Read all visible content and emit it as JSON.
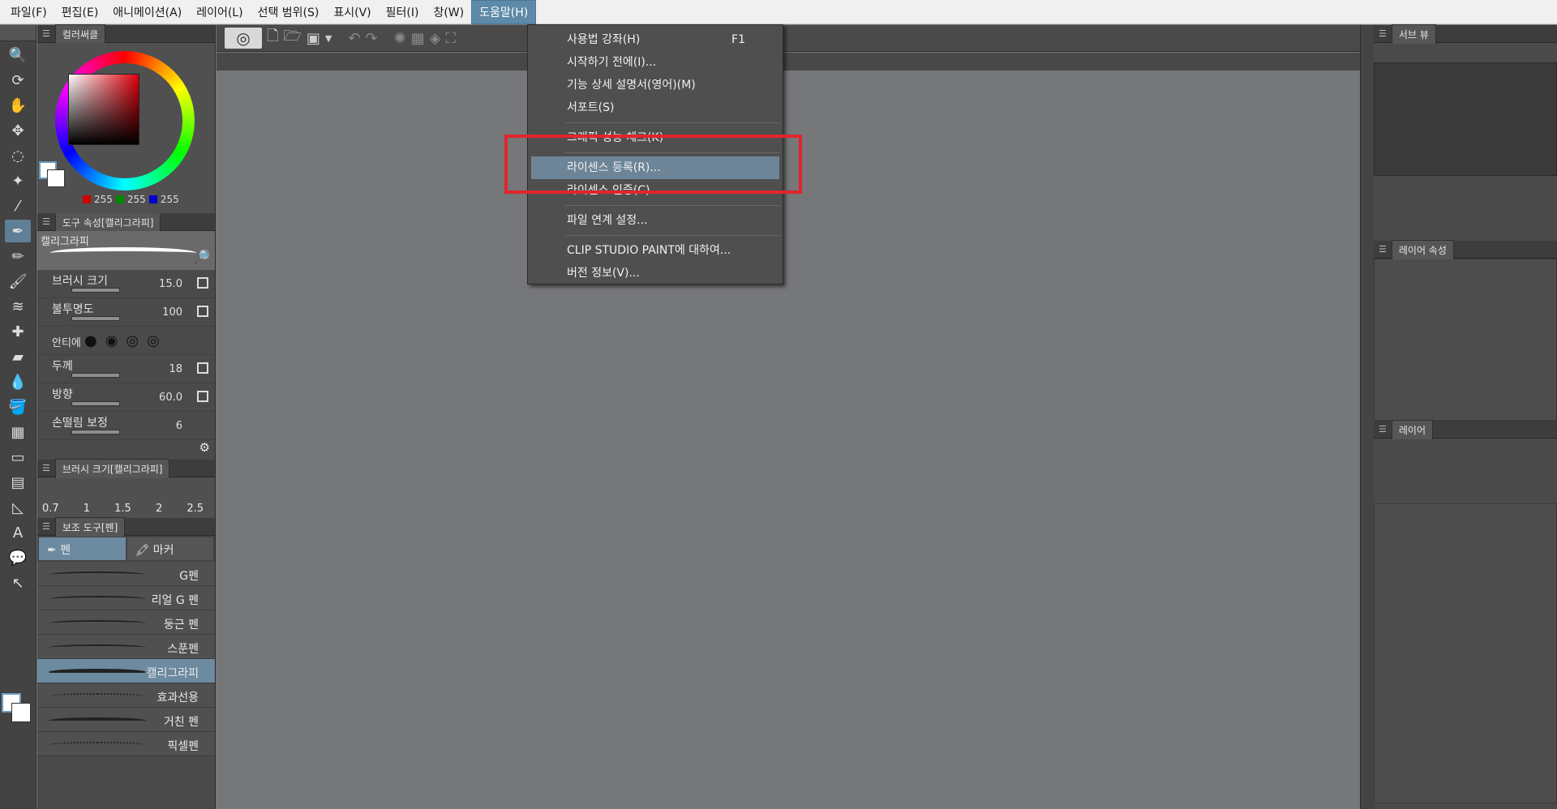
{
  "menubar": {
    "items": [
      "파일(F)",
      "편집(E)",
      "애니메이션(A)",
      "레이어(L)",
      "선택 범위(S)",
      "표시(V)",
      "필터(I)",
      "창(W)",
      "도움말(H)"
    ],
    "active_index": 8
  },
  "help_menu": {
    "items": [
      {
        "label": "사용법 강좌(H)",
        "shortcut": "F1"
      },
      {
        "label": "시작하기 전에(I)..."
      },
      {
        "label": "기능 상세 설명서(영어)(M)"
      },
      {
        "label": "서포트(S)"
      },
      {
        "label": "그래픽 성능 체크(K)"
      },
      {
        "label": "라이센스 등록(R)..."
      },
      {
        "label": "라이센스 인증(C)"
      },
      {
        "label": "파일 연계 설정..."
      },
      {
        "label": "CLIP STUDIO PAINT에 대하여..."
      },
      {
        "label": "버전 정보(V)..."
      }
    ],
    "highlighted_index": 5
  },
  "color_panel": {
    "tab_label": "컬러써클",
    "r": "255",
    "g": "255",
    "b": "255"
  },
  "tool_property": {
    "header": "도구 속성[캘리그라피]",
    "preview_label": "캘리그라피",
    "rows": [
      {
        "label": "브러시 크기",
        "value": "15.0"
      },
      {
        "label": "불투명도",
        "value": "100"
      },
      {
        "label": "안티에",
        "value": ""
      },
      {
        "label": "두께",
        "value": "18"
      },
      {
        "label": "방향",
        "value": "60.0"
      },
      {
        "label": "손떨림 보정",
        "value": "6"
      }
    ]
  },
  "brush_size": {
    "header": "브러시 크기[캘리그라피]",
    "values": [
      "0.7",
      "1",
      "1.5",
      "2",
      "2.5"
    ]
  },
  "sub_tool": {
    "header": "보조 도구[펜]",
    "tabs": [
      "펜",
      "마커"
    ],
    "items": [
      "G펜",
      "리얼 G 펜",
      "둥근 펜",
      "스푼펜",
      "캘리그라피",
      "효과선용",
      "거친 펜",
      "픽셀펜"
    ],
    "selected_index": 4
  },
  "right_panel": {
    "subview_tab": "서브 뷰",
    "layer_property_tab": "레이어 속성",
    "layer_tab": "레이어"
  },
  "colors": {
    "menu_highlight": "#6d8597",
    "annotation_red": "#e2252b"
  }
}
